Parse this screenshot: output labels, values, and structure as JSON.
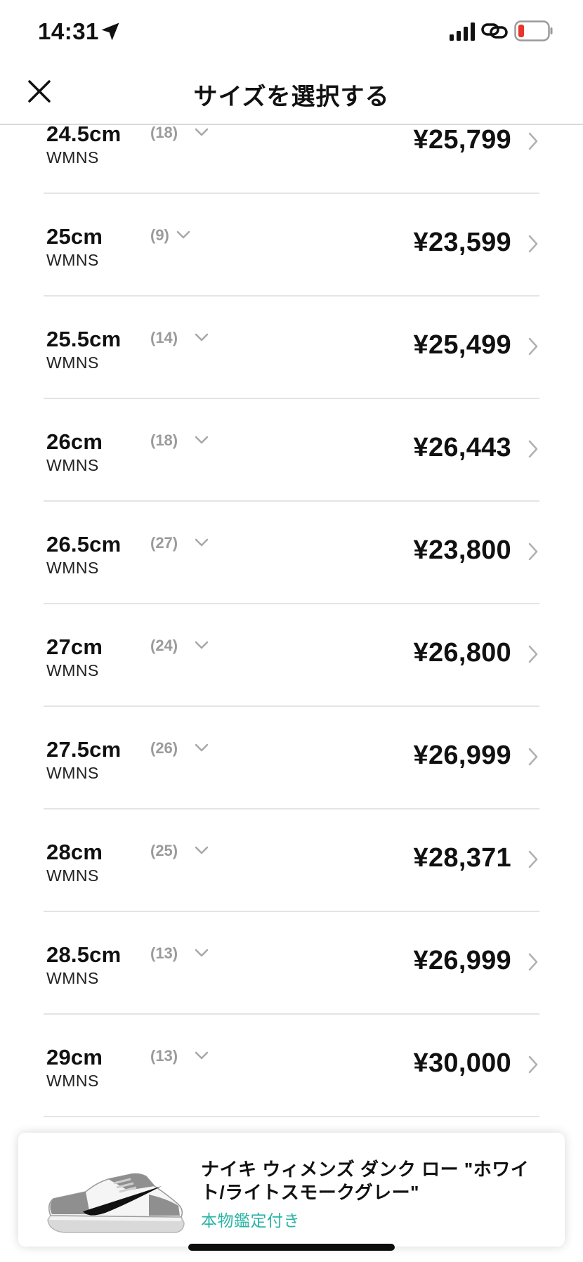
{
  "status_bar": {
    "time": "14:31"
  },
  "header": {
    "title": "サイズを選択する"
  },
  "sizes": [
    {
      "size": "24.5cm",
      "sub": "WMNS",
      "count": "(18)",
      "price": "¥25,799"
    },
    {
      "size": "25cm",
      "sub": "WMNS",
      "count": "(9)",
      "price": "¥23,599"
    },
    {
      "size": "25.5cm",
      "sub": "WMNS",
      "count": "(14)",
      "price": "¥25,499"
    },
    {
      "size": "26cm",
      "sub": "WMNS",
      "count": "(18)",
      "price": "¥26,443"
    },
    {
      "size": "26.5cm",
      "sub": "WMNS",
      "count": "(27)",
      "price": "¥23,800"
    },
    {
      "size": "27cm",
      "sub": "WMNS",
      "count": "(24)",
      "price": "¥26,800"
    },
    {
      "size": "27.5cm",
      "sub": "WMNS",
      "count": "(26)",
      "price": "¥26,999"
    },
    {
      "size": "28cm",
      "sub": "WMNS",
      "count": "(25)",
      "price": "¥28,371"
    },
    {
      "size": "28.5cm",
      "sub": "WMNS",
      "count": "(13)",
      "price": "¥26,999"
    },
    {
      "size": "29cm",
      "sub": "WMNS",
      "count": "(13)",
      "price": "¥30,000"
    }
  ],
  "product": {
    "name": "ナイキ ウィメンズ ダンク ロー \"ホワイト/ライトスモークグレー\"",
    "auth_label": "本物鑑定付き",
    "auth_color": "#2ab4a4"
  },
  "icons": {
    "close": "close-icon",
    "location": "location-arrow-icon",
    "signal": "cellular-signal-icon",
    "link": "link-icon",
    "battery": "battery-low-icon",
    "expand": "chevron-down-icon",
    "navigate": "chevron-right-icon"
  }
}
